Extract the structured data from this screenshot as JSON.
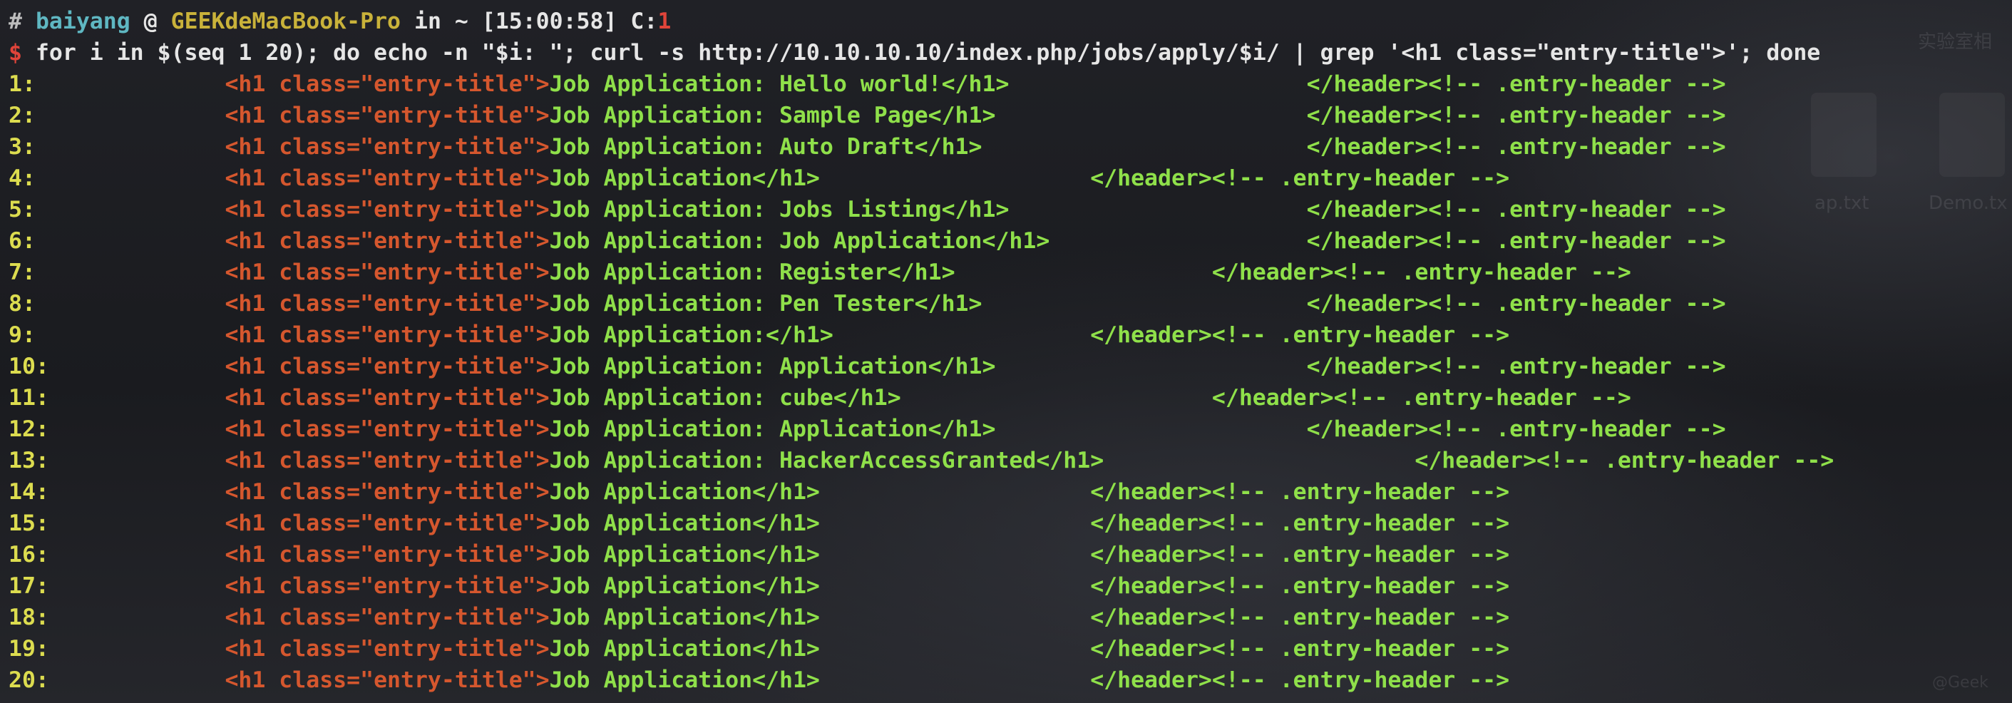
{
  "prompt": {
    "hash": "#",
    "user": "baiyang",
    "at": " @ ",
    "host": "GEEKdeMacBook-Pro",
    "in_text": " in ~ [15:00:58] C:",
    "exit_code": "1"
  },
  "command": {
    "dollar": "$",
    "text": " for i in $(seq 1 20); do echo -n \"$i: \"; curl -s http://10.10.10.10/index.php/jobs/apply/$i/ | grep '<h1 class=\"entry-title\">'; done"
  },
  "output": {
    "tag_open": "<h1 class=\"entry-title\">",
    "rows": [
      {
        "num": "1:",
        "gap": "              ",
        "content": "Job Application: Hello world!</h1>",
        "trail": "                      </header><!-- .entry-header -->"
      },
      {
        "num": "2:",
        "gap": "              ",
        "content": "Job Application: Sample Page</h1>",
        "trail": "                       </header><!-- .entry-header -->"
      },
      {
        "num": "3:",
        "gap": "              ",
        "content": "Job Application: Auto Draft</h1>",
        "trail": "                        </header><!-- .entry-header -->"
      },
      {
        "num": "4:",
        "gap": "              ",
        "content": "Job Application</h1>",
        "trail": "                    </header><!-- .entry-header -->"
      },
      {
        "num": "5:",
        "gap": "              ",
        "content": "Job Application: Jobs Listing</h1>",
        "trail": "                      </header><!-- .entry-header -->"
      },
      {
        "num": "6:",
        "gap": "              ",
        "content": "Job Application: Job Application</h1>",
        "trail": "                   </header><!-- .entry-header -->"
      },
      {
        "num": "7:",
        "gap": "              ",
        "content": "Job Application: Register</h1>",
        "trail": "                   </header><!-- .entry-header -->"
      },
      {
        "num": "8:",
        "gap": "              ",
        "content": "Job Application: Pen Tester</h1>",
        "trail": "                        </header><!-- .entry-header -->"
      },
      {
        "num": "9:",
        "gap": "              ",
        "content": "Job Application:</h1>",
        "trail": "                   </header><!-- .entry-header -->"
      },
      {
        "num": "10:",
        "gap": "             ",
        "content": "Job Application: Application</h1>",
        "trail": "                       </header><!-- .entry-header -->"
      },
      {
        "num": "11:",
        "gap": "             ",
        "content": "Job Application: cube</h1>",
        "trail": "                       </header><!-- .entry-header -->"
      },
      {
        "num": "12:",
        "gap": "             ",
        "content": "Job Application: Application</h1>",
        "trail": "                       </header><!-- .entry-header -->"
      },
      {
        "num": "13:",
        "gap": "             ",
        "content": "Job Application: HackerAccessGranted</h1>",
        "trail": "                       </header><!-- .entry-header -->"
      },
      {
        "num": "14:",
        "gap": "             ",
        "content": "Job Application</h1>",
        "trail": "                    </header><!-- .entry-header -->"
      },
      {
        "num": "15:",
        "gap": "             ",
        "content": "Job Application</h1>",
        "trail": "                    </header><!-- .entry-header -->"
      },
      {
        "num": "16:",
        "gap": "             ",
        "content": "Job Application</h1>",
        "trail": "                    </header><!-- .entry-header -->"
      },
      {
        "num": "17:",
        "gap": "             ",
        "content": "Job Application</h1>",
        "trail": "                    </header><!-- .entry-header -->"
      },
      {
        "num": "18:",
        "gap": "             ",
        "content": "Job Application</h1>",
        "trail": "                    </header><!-- .entry-header -->"
      },
      {
        "num": "19:",
        "gap": "             ",
        "content": "Job Application</h1>",
        "trail": "                    </header><!-- .entry-header -->"
      },
      {
        "num": "20:",
        "gap": "             ",
        "content": "Job Application</h1>",
        "trail": "                    </header><!-- .entry-header -->"
      }
    ]
  },
  "background": {
    "desktop_labels": [
      "实验室相",
      "ap.txt",
      "Demo.tx",
      "@Geek"
    ]
  },
  "colors": {
    "prompt_user": "#5fb7c2",
    "prompt_host": "#c9b23a",
    "exit_code": "#e0443a",
    "tag": "#d5572e",
    "content": "#8fe04a",
    "line_number": "#dcdc4f"
  }
}
